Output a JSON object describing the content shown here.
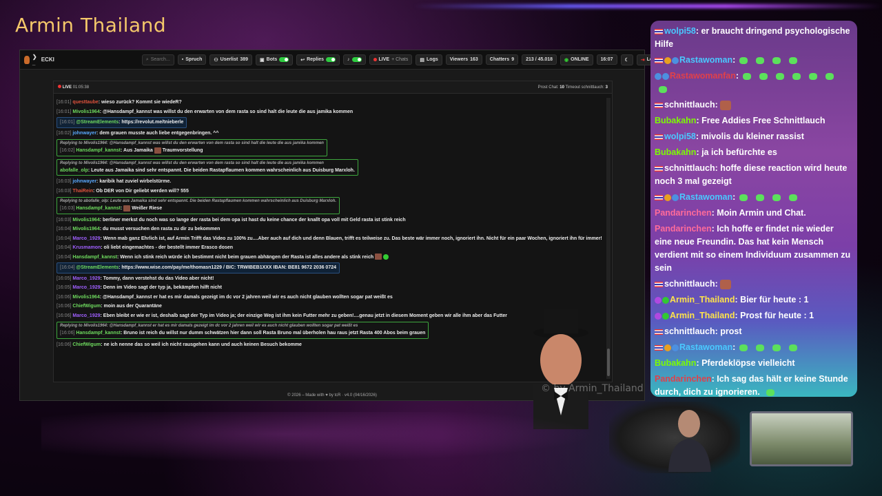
{
  "stream": {
    "title": "Armin Thailand",
    "watermark": "© by Armin_Thailand"
  },
  "navbar": {
    "brand": "ECKI",
    "search_placeholder": "Search...",
    "spruch": "Spruch",
    "userlist_label": "Userlist",
    "userlist_count": "389",
    "bots": "Bots",
    "replies": "Replies",
    "live": "LIVE",
    "chats": "+ Chats",
    "logs": "Logs",
    "viewers_label": "Viewers",
    "viewers_count": "163",
    "chatters_label": "Chatters",
    "chatters_count": "9",
    "ratio": "213 / 45.018",
    "status": "ONLINE",
    "time": "16:07",
    "logout": "Logout"
  },
  "live_bar": {
    "live": "LIVE",
    "duration": "01:05:38",
    "prost_label": "Prost Chat:",
    "prost_value": "10",
    "timeout_label": "Timeout schnittlauch:",
    "timeout_value": "3"
  },
  "messages": [
    {
      "ts": "[16:01]",
      "user": "questtaube",
      "text": ": wieso zurück? Kommt sie wiedeR?"
    },
    {
      "ts": "[16:01]",
      "user": "Mivolis1964",
      "text": ": @Hansdampf_kannst was willst du den erwarten von dem rasta so sind halt die leute die aus jamika kommen"
    },
    {
      "ts": "[16:01]",
      "user": "@StreamElements",
      "text": ": https://revolut.me/tnieberle"
    },
    {
      "ts": "[16:02]",
      "user": "johnwayer",
      "text": ": dem grauen musste auch liebe entgegenbringen. ^^"
    },
    {
      "ref": "Replying to Mivolis1964: @Hansdampf_kannst was willst du den erwarten von dem rasta so sind halt die leute die aus jamika kommen",
      "ts": "[16:02]",
      "user": "Hansdampf_kannst",
      "text": ": Aus Jamaika",
      "extra": "Traumvorstellung"
    },
    {
      "ref": "Replying to Mivolis1964: @Hansdampf_kannst was willst du den erwarten von dem rasta so sind halt die leute die aus jamika kommen",
      "user": "abofalle_olp",
      "text": ": Leute aus Jamaika sind sehr entspannt. Die beiden Rastapflaumen kommen wahrscheinlich aus Duisburg Marxloh."
    },
    {
      "ts": "[16:03]",
      "user": "johnwayer",
      "text": ": karibik hat zuviel wirbelstürme."
    },
    {
      "ts": "[16:03]",
      "user": "ThaiRein",
      "text": ": Ob DER von Dir geliebt werden will? 555"
    },
    {
      "ref": "Replying to abofalle_olp: Leute aus Jamaika sind sehr entspannt. Die beiden Rastapflaumen kommen wahrscheinlich aus Duisburg Marxloh.",
      "ts": "[16:03]",
      "user": "Hansdampf_kannst",
      "text": ":",
      "extra": "Weißer Riese"
    },
    {
      "ts": "[16:03]",
      "user": "Mivolis1964",
      "text": ": berliner merkst du noch was so lange der rasta bei dem opa ist hast du keine chance der knallt opa voll mit Geld rasta ist stink reich"
    },
    {
      "ts": "[16:04]",
      "user": "Mivolis1964",
      "text": ": du musst versuchen den rasta zu dir zu bekommen"
    },
    {
      "ts": "[16:04]",
      "user": "Marco_1929",
      "text": ": Wenn mab ganz Ehrlich ist, auf Armin Trifft das Video zu 100% zu....Aber auch auf dich und denn Blauen, trifft es teilweise zu. Das beste wär immer noch, ignoriert ihn. Nicht für ein paar Wochen, ignoriert ihn für immer!"
    },
    {
      "ts": "[16:04]",
      "user": "Krusmamon",
      "text": ": oli liebt eingemachtes - der bestellt immer Erasco dosen"
    },
    {
      "ts": "[16:04]",
      "user": "Hansdampf_kannst",
      "text": ": Wenn ich stink reich würde ich bestimmt nicht beim grauen abhängen der Rasta ist alles andere als stink reich"
    },
    {
      "ts": "[16:04]",
      "user": "@StreamElements",
      "text": ": https://www.wise.com/pay/me/thomasn1229 / BIC: TRWIBEB1XXX IBAN: BE81 9672 2036 0724"
    },
    {
      "ts": "[16:05]",
      "user": "Marco_1929",
      "text": ": Tommy, dann verstehst du das Video aber nicht!"
    },
    {
      "ts": "[16:05]",
      "user": "Marco_1929",
      "text": ": Denn im Video sagt der typ ja, bekämpfen hilft nicht"
    },
    {
      "ts": "[16:06]",
      "user": "Mivolis1964",
      "text": ": @Hansdampf_kannst er hat es mir damals gezeigt im dc vor 2 jahren weil wir es auch nicht glauben wollten sogar pat weißt es"
    },
    {
      "ts": "[16:06]",
      "user": "ChiefWigum",
      "text": ": moin aus der Quarantäne"
    },
    {
      "ts": "[16:06]",
      "user": "Marco_1929",
      "text": ": Eben bleibt er wie er ist, deshalb sagt der Typ im Video ja; der einzige Weg ist ihm kein Futter mehr zu geben!....genau jetzt in diesem Moment geben wir alle ihm aber das Futter"
    },
    {
      "ref": "Replying to Mivolis1964: @Hansdampf_kannst er hat es mir damals gezeigt im dc vor 2 jahren weil wir es auch nicht glauben wollten sogar pat weißt es",
      "ts": "[16:06]",
      "user": "Hansdampf_kannst",
      "text": ": Bruno ist reich du willst nur dumm schwätzen hier dann soll Rasta Bruno mal überholen hau raus jetzt Rasta 400 Abos beim grauen"
    },
    {
      "ts": "[16:06]",
      "user": "ChiefWigum",
      "text": ": ne ich nenne das so weil ich nicht rausgehen kann und auch keinen Besuch bekomme"
    }
  ],
  "footer": "© 2026 – Made with ♥ by tcR · v4.0 (04/16/2026)",
  "overlay_chat": [
    {
      "user": "wolpi58",
      "text": ": er braucht dringend psychologische Hilfe",
      "color": "blue"
    },
    {
      "user": "Rastawoman",
      "text": ":",
      "color": "blue",
      "gems": 4
    },
    {
      "user": "Rastawomanfan",
      "text": ":",
      "color": "red",
      "gems": 7
    },
    {
      "user": "schnittlauch",
      "text": ":",
      "color": "pink"
    },
    {
      "user": "Bubakahn",
      "text": ": Free Addies Free Schnittlauch",
      "color": "green"
    },
    {
      "user": "wolpi58",
      "text": ": mivolis du kleiner rassist",
      "color": "blue"
    },
    {
      "user": "Bubakahn",
      "text": ": ja ich befürchte es",
      "color": "green"
    },
    {
      "user": "schnittlauch",
      "text": ": hoffe diese reaction wird heute noch 3 mal gezeigt",
      "color": "pink"
    },
    {
      "user": "Rastawoman",
      "text": ":",
      "color": "blue",
      "gems": 4
    },
    {
      "user": "Pandarinchen",
      "text": ": Moin Armin und Chat.",
      "color": "pink"
    },
    {
      "user": "Pandarinchen",
      "text": ": Ich hoffe er findet nie wieder eine neue Freundin. Das hat kein Mensch verdient mit so einem Individuum zusammen zu sein",
      "color": "pink"
    },
    {
      "user": "schnittlauch",
      "text": ":",
      "color": "pink"
    },
    {
      "user": "Armin_Thailand",
      "text": ": Bier für heute : 1",
      "color": "yellow"
    },
    {
      "user": "Armin_Thailand",
      "text": ": Prost für heute : 1",
      "color": "yellow"
    },
    {
      "user": "schnittlauch",
      "text": ": prost",
      "color": "pink"
    },
    {
      "user": "Rastawoman",
      "text": ":",
      "color": "blue",
      "gems": 4
    },
    {
      "user": "Bubakahn",
      "text": ": Pferdeklöpse vielleicht",
      "color": "green"
    },
    {
      "user": "Pandarinchen",
      "text": ": Ich sag das hält er keine Stunde durch, dich zu ignorieren.",
      "color": "red"
    }
  ]
}
